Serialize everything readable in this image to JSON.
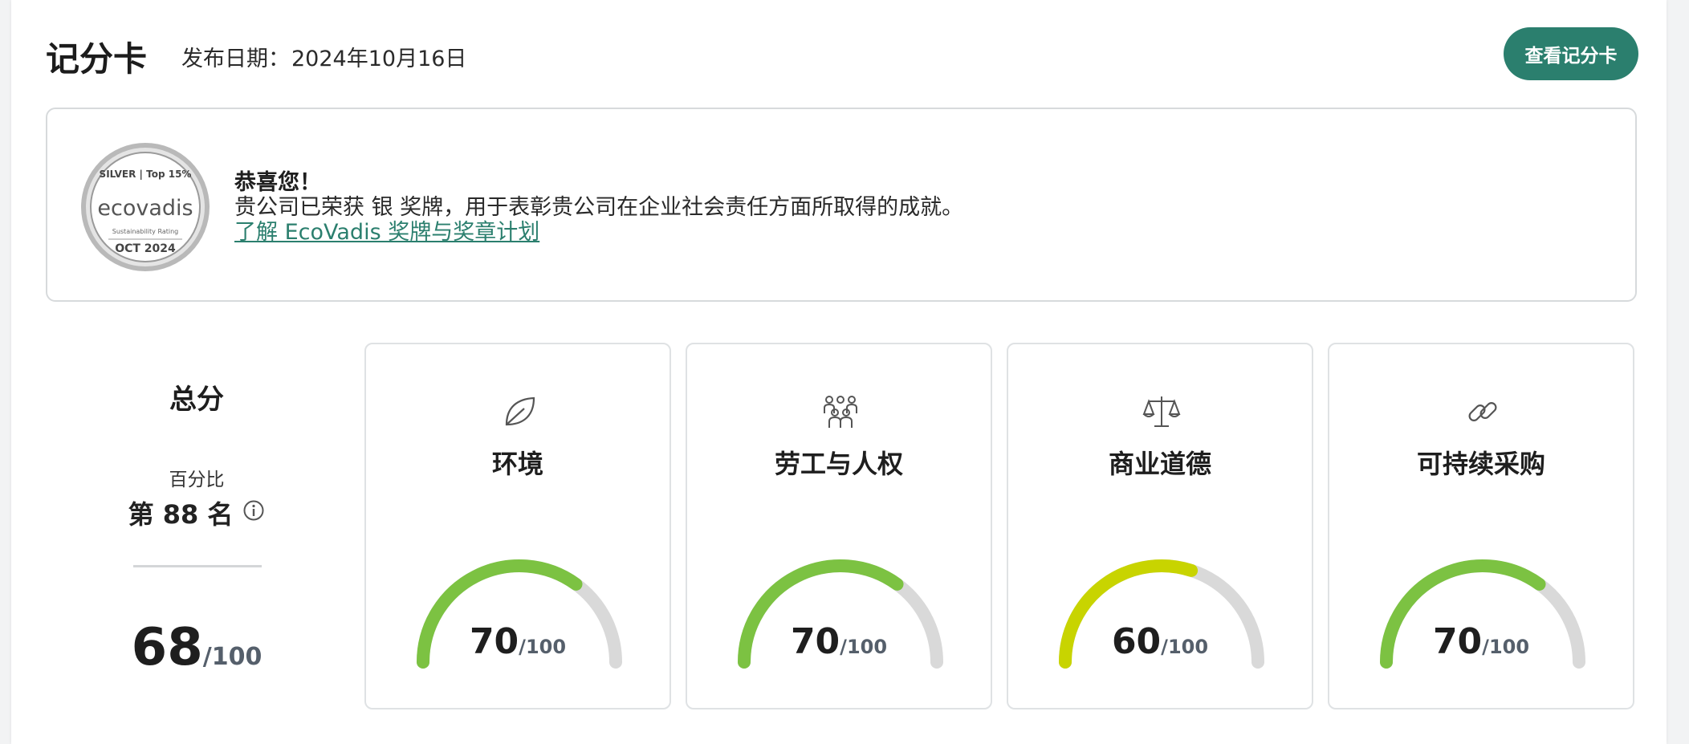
{
  "header": {
    "title": "记分卡",
    "date_label": "发布日期：",
    "date_value": "2024年10月16日",
    "view_button": "查看记分卡"
  },
  "award": {
    "medal": {
      "tier": "SILVER",
      "top": "Top 15%",
      "brand": "ecovadis",
      "rating_label": "Sustainability Rating",
      "date": "OCT 2024"
    },
    "heading": "恭喜您！",
    "body": "贵公司已荣获 银 奖牌，用于表彰贵公司在企业社会责任方面所取得的成就。",
    "link": "了解 EcoVadis 奖牌与奖章计划"
  },
  "overall": {
    "title": "总分",
    "percentile_label": "百分比",
    "rank": "第 88 名",
    "score": 68,
    "max": "/100"
  },
  "themes": [
    {
      "name": "环境",
      "icon": "leaf-icon",
      "score": 70,
      "max": "/100",
      "color": "#7cc242"
    },
    {
      "name": "劳工与人权",
      "icon": "people-icon",
      "score": 70,
      "max": "/100",
      "color": "#7cc242"
    },
    {
      "name": "商业道德",
      "icon": "scales-icon",
      "score": 60,
      "max": "/100",
      "color": "#c8d400"
    },
    {
      "name": "可持续采购",
      "icon": "chain-link-icon",
      "score": 70,
      "max": "/100",
      "color": "#7cc242"
    }
  ],
  "colors": {
    "accent": "#2b7f6e",
    "gauge_track": "#d9d9d9"
  }
}
